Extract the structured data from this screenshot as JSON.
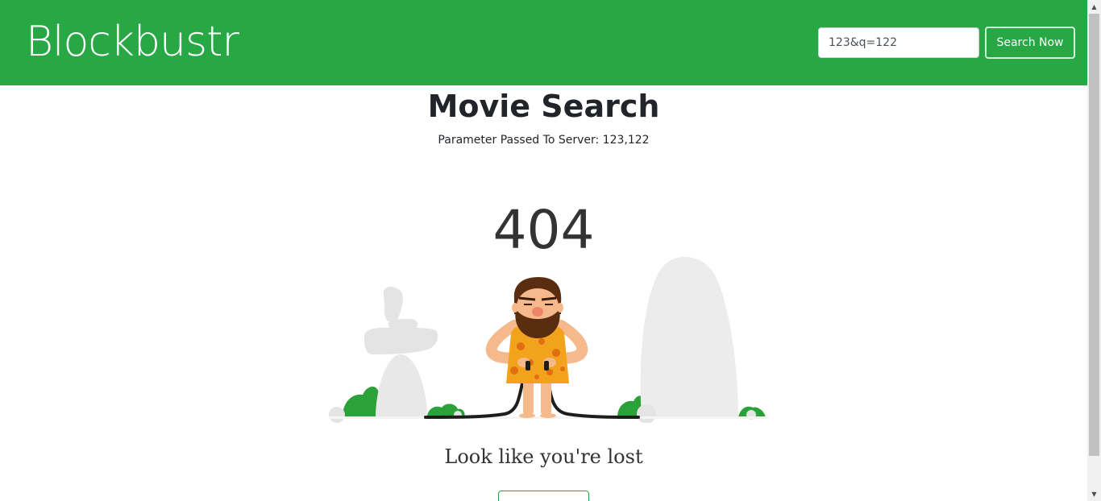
{
  "navbar": {
    "brand": "Blockbustr",
    "search": {
      "value": "123&q=122"
    },
    "search_button_label": "Search Now"
  },
  "main": {
    "title": "Movie Search",
    "parameter_text": "Parameter Passed To Server: 123,122",
    "error_code": "404",
    "lost_message": "Look like you're lost",
    "home_button_label": ""
  },
  "colors": {
    "brand_green": "#28a745",
    "heading_text": "#212529",
    "rock_gray": "#ececec"
  },
  "icons": {
    "scroll_up": "scroll-up-arrow-icon",
    "scroll_down": "scroll-down-arrow-icon"
  }
}
